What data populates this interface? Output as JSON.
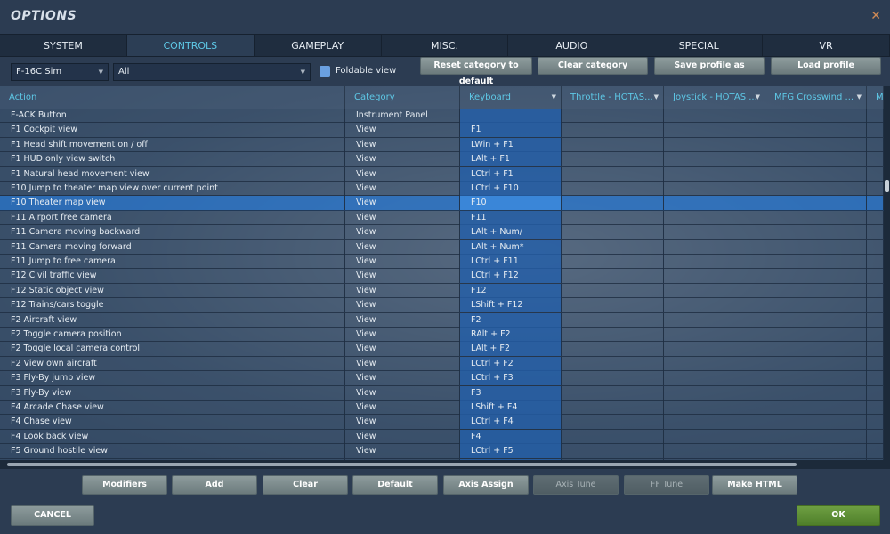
{
  "window": {
    "title": "OPTIONS",
    "close_icon": "close-icon"
  },
  "tabs": [
    {
      "label": "SYSTEM"
    },
    {
      "label": "CONTROLS",
      "active": true
    },
    {
      "label": "GAMEPLAY"
    },
    {
      "label": "MISC."
    },
    {
      "label": "AUDIO"
    },
    {
      "label": "SPECIAL"
    },
    {
      "label": "VR"
    }
  ],
  "toolbar": {
    "aircraft": "F-16C Sim",
    "category_filter": "All",
    "foldable_label": "Foldable view",
    "foldable_checked": false,
    "reset": "Reset category to default",
    "clear": "Clear category",
    "save": "Save profile as",
    "load": "Load profile"
  },
  "columns": [
    "Action",
    "Category",
    "Keyboard",
    "Throttle - HOTAS...",
    "Joystick - HOTAS ...",
    "MFG Crosswind ...",
    "M"
  ],
  "rows": [
    {
      "action": "F-ACK Button",
      "category": "Instrument Panel",
      "keyboard": ""
    },
    {
      "action": "F1 Cockpit view",
      "category": "View",
      "keyboard": "F1"
    },
    {
      "action": "F1 Head shift movement on / off",
      "category": "View",
      "keyboard": "LWin + F1"
    },
    {
      "action": "F1 HUD only view switch",
      "category": "View",
      "keyboard": "LAlt + F1"
    },
    {
      "action": "F1 Natural head movement view",
      "category": "View",
      "keyboard": "LCtrl + F1"
    },
    {
      "action": "F10 Jump to theater map view over current point",
      "category": "View",
      "keyboard": "LCtrl + F10"
    },
    {
      "action": "F10 Theater map view",
      "category": "View",
      "keyboard": "F10",
      "selected": true
    },
    {
      "action": "F11 Airport free camera",
      "category": "View",
      "keyboard": "F11"
    },
    {
      "action": "F11 Camera moving backward",
      "category": "View",
      "keyboard": "LAlt + Num/"
    },
    {
      "action": "F11 Camera moving forward",
      "category": "View",
      "keyboard": "LAlt + Num*"
    },
    {
      "action": "F11 Jump to free camera",
      "category": "View",
      "keyboard": "LCtrl + F11"
    },
    {
      "action": "F12 Civil traffic view",
      "category": "View",
      "keyboard": "LCtrl + F12"
    },
    {
      "action": "F12 Static object view",
      "category": "View",
      "keyboard": "F12"
    },
    {
      "action": "F12 Trains/cars toggle",
      "category": "View",
      "keyboard": "LShift + F12"
    },
    {
      "action": "F2 Aircraft view",
      "category": "View",
      "keyboard": "F2"
    },
    {
      "action": "F2 Toggle camera position",
      "category": "View",
      "keyboard": "RAlt + F2"
    },
    {
      "action": "F2 Toggle local camera control",
      "category": "View",
      "keyboard": "LAlt + F2"
    },
    {
      "action": "F2 View own aircraft",
      "category": "View",
      "keyboard": "LCtrl + F2"
    },
    {
      "action": "F3 Fly-By jump view",
      "category": "View",
      "keyboard": "LCtrl + F3"
    },
    {
      "action": "F3 Fly-By view",
      "category": "View",
      "keyboard": "F3"
    },
    {
      "action": "F4 Arcade Chase view",
      "category": "View",
      "keyboard": "LShift + F4"
    },
    {
      "action": "F4 Chase view",
      "category": "View",
      "keyboard": "LCtrl + F4"
    },
    {
      "action": "F4 Look back view",
      "category": "View",
      "keyboard": "F4"
    },
    {
      "action": "F5 Ground hostile view",
      "category": "View",
      "keyboard": "LCtrl + F5"
    }
  ],
  "actions": [
    "Modifiers",
    "Add",
    "Clear",
    "Default",
    "Axis Assign",
    "Axis Tune",
    "FF Tune",
    "Make HTML"
  ],
  "footer": {
    "cancel": "CANCEL",
    "ok": "OK"
  },
  "colors": {
    "accent": "#5ec8e6",
    "ok": "#5a8c32",
    "selected_row": "#3a86d8"
  }
}
